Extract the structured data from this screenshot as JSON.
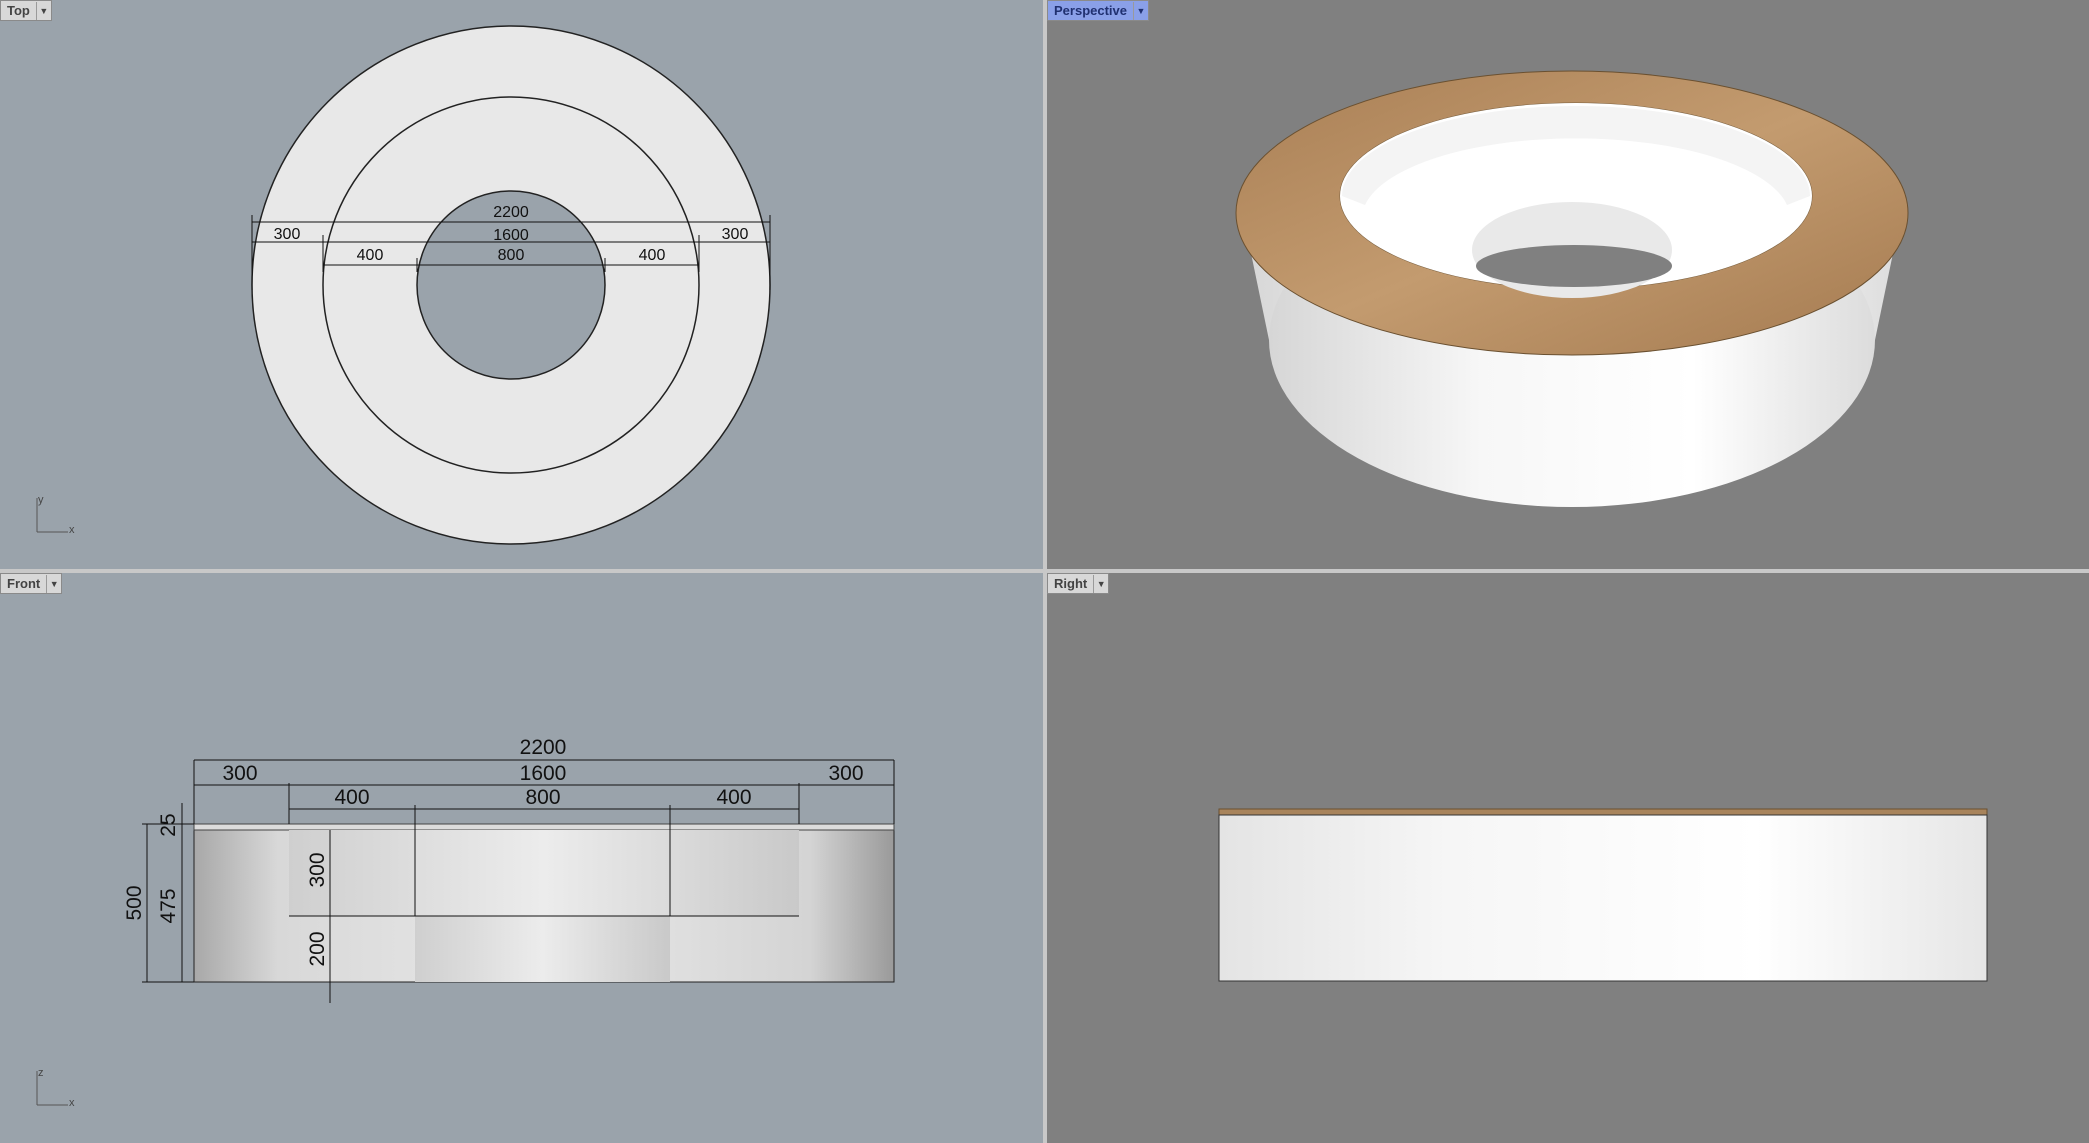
{
  "viewports": {
    "top": {
      "label": "Top",
      "axis_x": "x",
      "axis_y": "y"
    },
    "perspective": {
      "label": "Perspective"
    },
    "front": {
      "label": "Front",
      "axis_x": "x",
      "axis_z": "z"
    },
    "right": {
      "label": "Right"
    }
  },
  "dimensions": {
    "top": {
      "overall": "2200",
      "middle": "1600",
      "inner": "800",
      "left_outer": "300",
      "right_outer": "300",
      "left_mid": "400",
      "right_mid": "400"
    },
    "front": {
      "overall": "2200",
      "middle": "1600",
      "inner": "800",
      "left_outer": "300",
      "right_outer": "300",
      "left_mid": "400",
      "right_mid": "400",
      "total_height": "500",
      "lip": "25",
      "body_height": "475",
      "upper_step": "300",
      "lower_step": "200"
    }
  },
  "colors": {
    "viewport_bg_gray_blue": "#9aa3ab",
    "viewport_bg_gray": "#808080",
    "active_tab": "#8aa0e8",
    "wood_top": "#b88c5e",
    "white_body": "#f2f2f2"
  }
}
